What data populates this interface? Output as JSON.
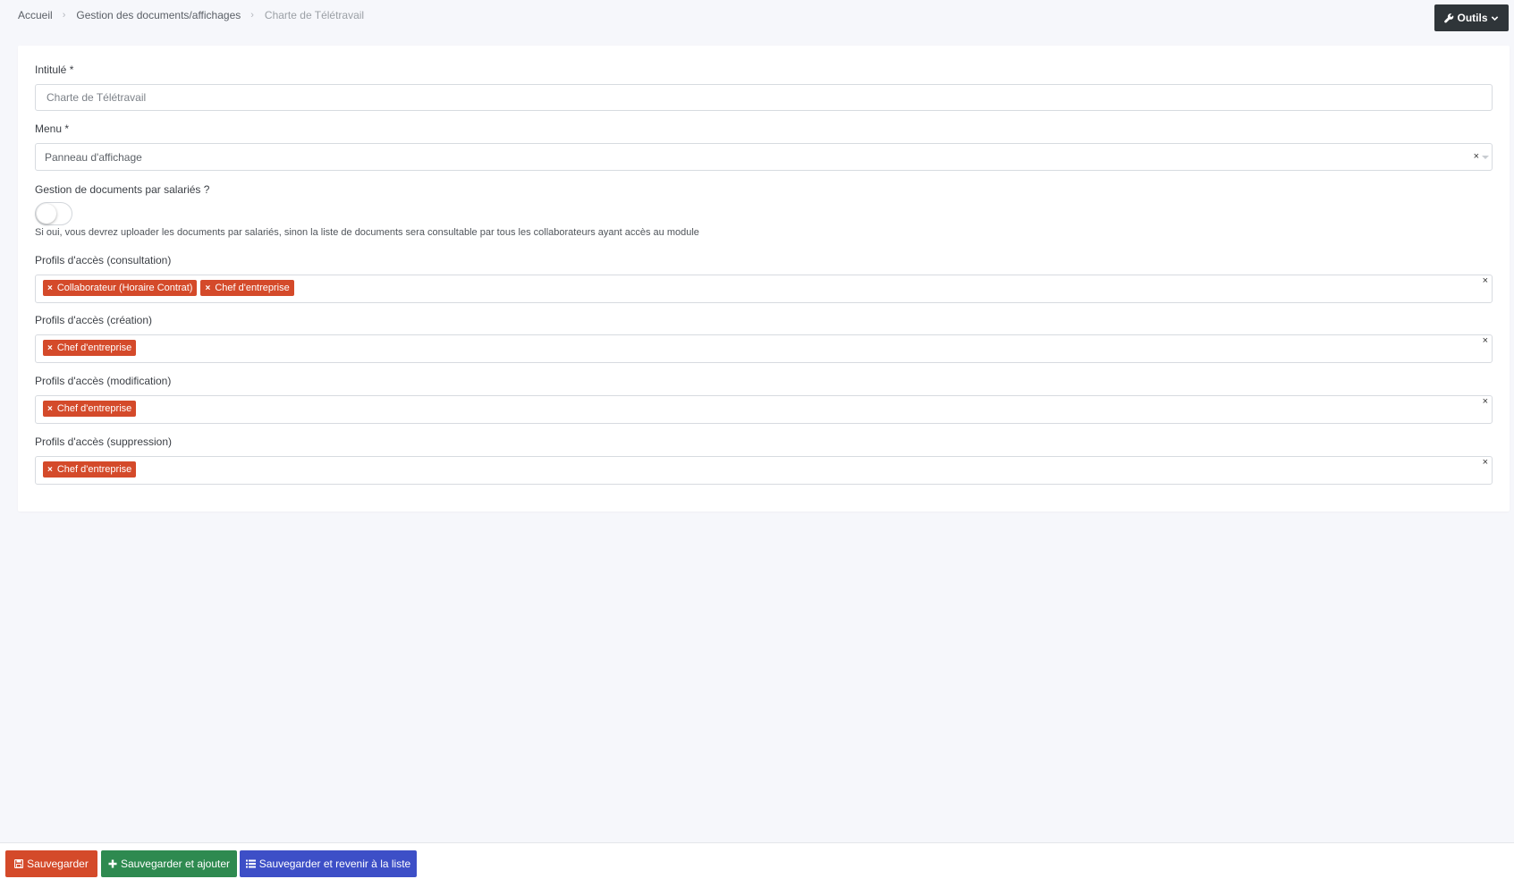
{
  "breadcrumb": {
    "home": "Accueil",
    "section": "Gestion des documents/affichages",
    "current": "Charte de Télétravail"
  },
  "toolbar": {
    "tools_label": "Outils",
    "tools_icon": "wrench-icon"
  },
  "form": {
    "title_field": {
      "label": "Intitulé *",
      "value": "Charte de Télétravail"
    },
    "menu_field": {
      "label": "Menu *",
      "selected": "Panneau d'affichage",
      "clear": "×"
    },
    "employee_docs": {
      "label": "Gestion de documents par salariés ?",
      "enabled": false,
      "help": "Si oui, vous devrez uploader les documents par salariés, sinon la liste de documents sera consultable par tous les collaborateurs ayant accès au module"
    },
    "access_consultation": {
      "label": "Profils d'accès (consultation)",
      "tags": [
        "Collaborateur (Horaire Contrat)",
        "Chef d'entreprise"
      ]
    },
    "access_creation": {
      "label": "Profils d'accès (création)",
      "tags": [
        "Chef d'entreprise"
      ]
    },
    "access_modification": {
      "label": "Profils d'accès (modification)",
      "tags": [
        "Chef d'entreprise"
      ]
    },
    "access_suppression": {
      "label": "Profils d'accès (suppression)",
      "tags": [
        "Chef d'entreprise"
      ]
    },
    "tag_remove": "×",
    "clear_all": "×"
  },
  "footer": {
    "save_label": "Sauvegarder",
    "save_add_label": "Sauvegarder et ajouter",
    "save_list_label": "Sauvegarder et revenir à la liste"
  },
  "colors": {
    "tag": "#d44a2a",
    "save": "#d44a2a",
    "save_add": "#2e8a50",
    "save_list": "#3d4fc7",
    "tools": "#2f3539"
  }
}
